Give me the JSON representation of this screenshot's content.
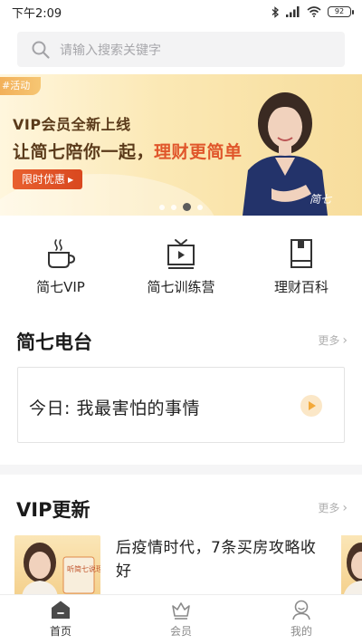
{
  "status_bar": {
    "time": "下午2:09",
    "battery": "92",
    "icons": [
      "bluetooth-icon",
      "signal-icon",
      "wifi-icon",
      "battery-icon"
    ]
  },
  "search": {
    "placeholder": "请输入搜索关键字",
    "icon": "search-icon"
  },
  "banner": {
    "tag": "#活动",
    "line1": "VIP会员全新上线",
    "line2_prefix": "让简七陪你一起，",
    "line2_highlight": "理财更简单",
    "button": "限时优惠",
    "signature": "简七",
    "slide_count": 4,
    "active_slide": 3,
    "colors": {
      "accent": "#e0562b",
      "text": "#5a3a1a",
      "background": "#fbe8b4"
    }
  },
  "categories": [
    {
      "label": "简七VIP",
      "icon": "coffee-cup-icon"
    },
    {
      "label": "简七训练营",
      "icon": "tv-play-icon"
    },
    {
      "label": "理财百科",
      "icon": "book-icon"
    }
  ],
  "radio_section": {
    "title": "简七电台",
    "more": "更多",
    "item_title": "今日: 我最害怕的事情",
    "play_icon": "play-icon"
  },
  "vip_section": {
    "title": "VIP更新",
    "more": "更多",
    "thumb_caption": "听简七说理财",
    "item_title": "后疫情时代，7条买房攻略收好"
  },
  "bottom_nav": [
    {
      "label": "首页",
      "icon": "home-icon",
      "active": true
    },
    {
      "label": "会员",
      "icon": "crown-icon",
      "active": false
    },
    {
      "label": "我的",
      "icon": "profile-icon",
      "active": false
    }
  ]
}
